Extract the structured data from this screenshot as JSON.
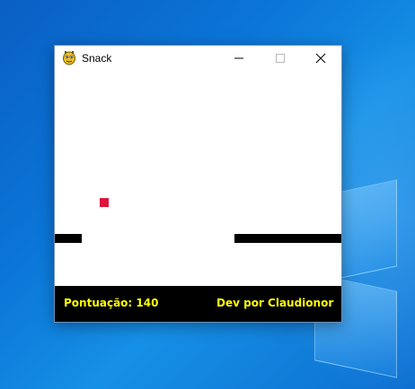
{
  "window": {
    "title": "Snack",
    "app_icon": "pygame-snake-icon",
    "controls": {
      "minimize": "minimize-icon",
      "maximize": "maximize-icon",
      "close": "close-icon"
    }
  },
  "game": {
    "food_color": "#dc143c",
    "wall_color": "#000000",
    "background": "#ffffff"
  },
  "footer": {
    "score_text": "Pontuação: 140",
    "credit_text": "Dev por Claudionor",
    "text_color": "#ffff00",
    "background": "#000000"
  },
  "desktop": {
    "background_color": "#0b76d8"
  }
}
